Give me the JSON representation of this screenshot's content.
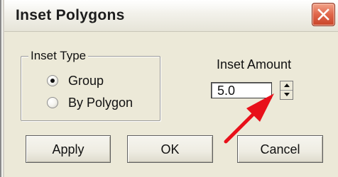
{
  "window": {
    "title": "Inset Polygons"
  },
  "inset_type": {
    "legend": "Inset Type",
    "options": [
      {
        "label": "Group",
        "selected": true
      },
      {
        "label": "By Polygon",
        "selected": false
      }
    ]
  },
  "inset_amount": {
    "label": "Inset Amount",
    "value": "5.0"
  },
  "buttons": {
    "apply": "Apply",
    "ok": "OK",
    "cancel": "Cancel"
  },
  "colors": {
    "close_button": "#e0664a",
    "annotation_arrow": "#e8101a"
  },
  "icons": {
    "close": "close-icon",
    "annotation": "red-arrow-annotation"
  }
}
